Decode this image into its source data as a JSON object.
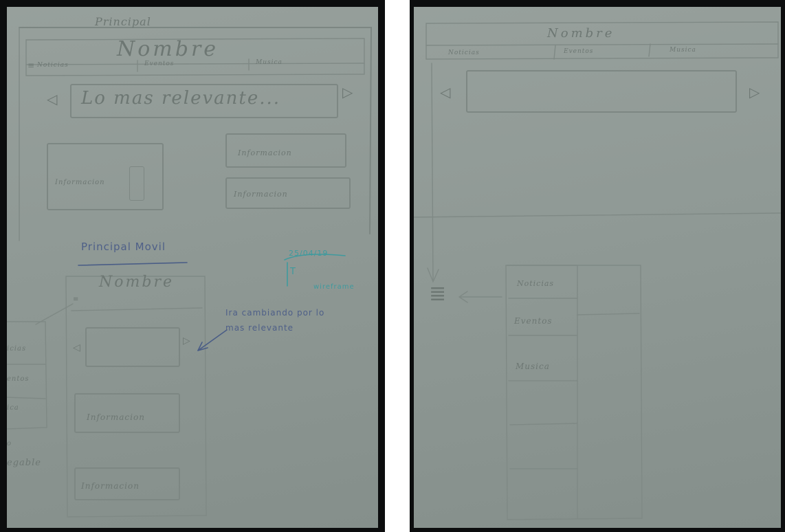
{
  "left_sheet": {
    "desktop": {
      "title": "Principal",
      "app_name": "Nombre",
      "nav": [
        "Noticias",
        "Eventos",
        "Musica"
      ],
      "hamburger": "≡",
      "carousel_text": "Lo mas relevante...",
      "arrow_left": "◁",
      "arrow_right": "▷",
      "info_left": "Informacion",
      "info_right_top": "Informacion",
      "info_right_bottom": "Informacion"
    },
    "mobile": {
      "title": "Principal Movil",
      "app_name": "Nombre",
      "hamburger": "≡",
      "arrow_left": "◁",
      "arrow_right": "▷",
      "annotation": "Ira cambiando por lo mas relevante",
      "info_1": "Informacion",
      "info_2": "Informacion",
      "side_menu_fragments": [
        "icias",
        "entos",
        "ica"
      ],
      "fragment_bottom_1": "o",
      "fragment_bottom_2": "egable"
    },
    "stamp": {
      "date": "25/04/19",
      "mark": "T",
      "label": "wireframe"
    }
  },
  "right_sheet": {
    "app_name": "Nombre",
    "nav": [
      "Noticias",
      "Eventos",
      "Musica"
    ],
    "arrow_left": "◁",
    "arrow_right": "▷",
    "menu_icon": "≣",
    "side_menu": [
      "Noticias",
      "Eventos",
      "Musica"
    ]
  }
}
